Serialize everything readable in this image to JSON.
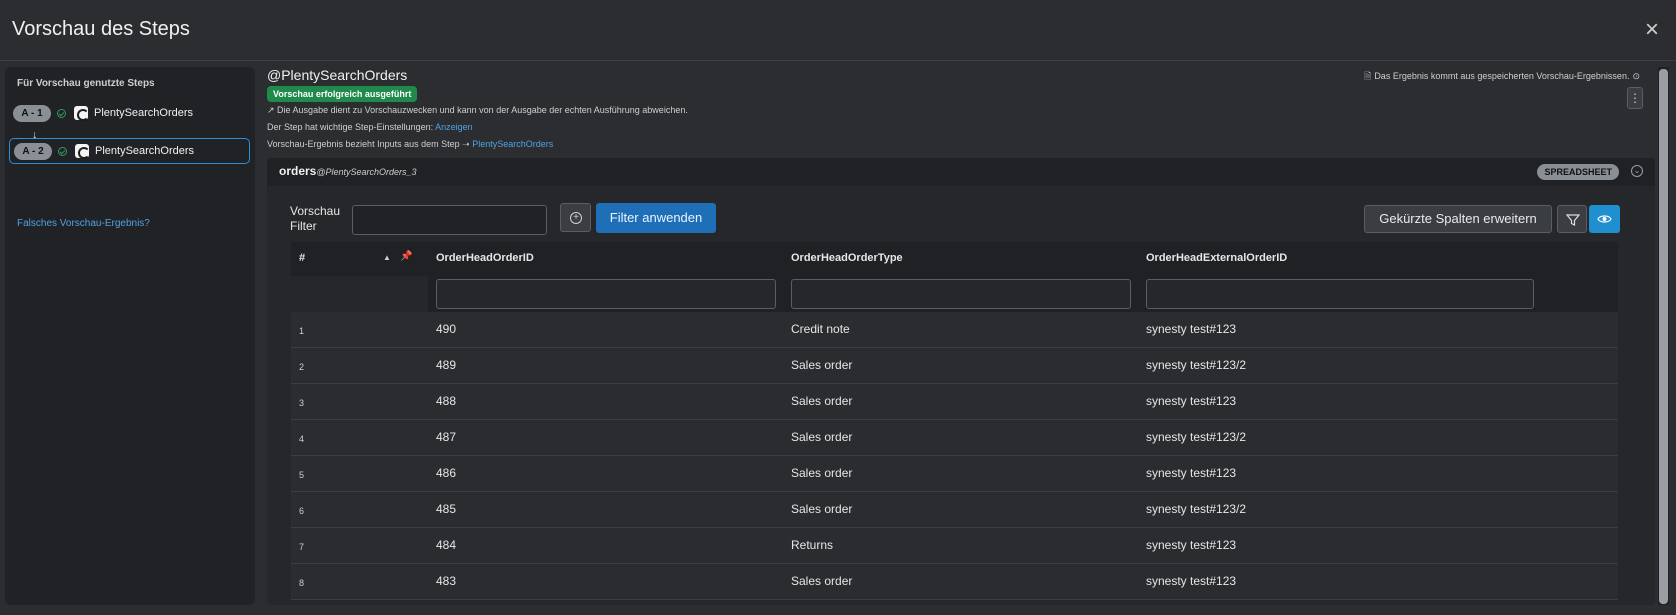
{
  "modal": {
    "title": "Vorschau des Steps",
    "close_label": "×"
  },
  "sidebar": {
    "title": "Für Vorschau genutzte Steps",
    "steps": [
      {
        "badge": "A - 1",
        "label": "PlentySearchOrders",
        "active": false
      },
      {
        "badge": "A - 2",
        "label": "PlentySearchOrders",
        "active": true
      }
    ],
    "arrow": "↓",
    "wrong_result_link": "Falsches Vorschau-Ergebnis?"
  },
  "main": {
    "step_name": "@PlentySearchOrders",
    "status_badge": "Vorschau erfolgreich ausgeführt",
    "info_disclaimer": "↗  Die Ausgabe dient zu Vorschauzwecken und kann von der Ausgabe der echten Ausführung abweichen.",
    "settings_text": "Der Step hat wichtige Step-Einstellungen:",
    "settings_link": "Anzeigen",
    "inputs_text": "Vorschau-Ergebnis bezieht Inputs aus dem Step ➝",
    "inputs_link": "PlentySearchOrders",
    "saved_note": "Das Ergebnis kommt aus gespeicherten Vorschau-Ergebnissen.",
    "kebab": "⋮"
  },
  "panel": {
    "title": "orders",
    "subtitle": "@PlentySearchOrders_3",
    "badge": "SPREADSHEET",
    "filter_label_1": "Vorschau",
    "filter_label_2": "Filter",
    "filter_value": "",
    "apply_label": "Filter anwenden",
    "expand_label": "Gekürzte Spalten erweitern"
  },
  "table": {
    "headers": [
      "#",
      "OrderHeadOrderID",
      "OrderHeadOrderType",
      "OrderHeadExternalOrderID"
    ],
    "rows": [
      [
        "1",
        "490",
        "Credit note",
        "synesty test#123"
      ],
      [
        "2",
        "489",
        "Sales order",
        "synesty test#123/2"
      ],
      [
        "3",
        "488",
        "Sales order",
        "synesty test#123"
      ],
      [
        "4",
        "487",
        "Sales order",
        "synesty test#123/2"
      ],
      [
        "5",
        "486",
        "Sales order",
        "synesty test#123"
      ],
      [
        "6",
        "485",
        "Sales order",
        "synesty test#123/2"
      ],
      [
        "7",
        "484",
        "Returns",
        "synesty test#123"
      ],
      [
        "8",
        "483",
        "Sales order",
        "synesty test#123"
      ]
    ]
  },
  "colors": {
    "accent": "#1f6fb8",
    "success": "#1f8a4c",
    "link": "#4fa3e0",
    "background": "#2b2d30"
  }
}
